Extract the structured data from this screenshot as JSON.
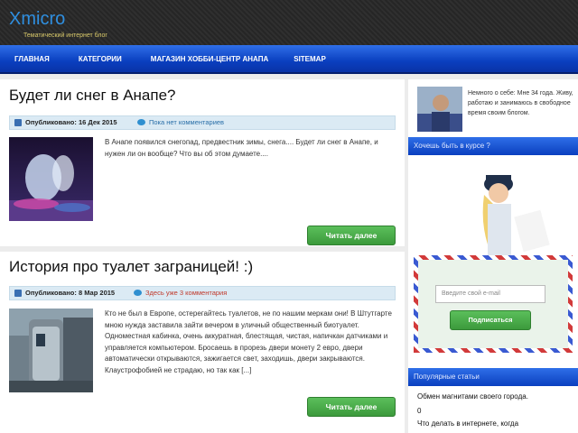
{
  "header": {
    "logo": "Xmicro",
    "tagline": "Тематический интернет блог"
  },
  "nav": {
    "items": [
      "Главная",
      "Категории",
      "Магазин хобби-центр Анапа",
      "Sitemap"
    ]
  },
  "posts": [
    {
      "title": "Будет ли снег в Анапе?",
      "date": "Опубликовано: 16 Дек 2015",
      "comments": "Пока нет комментариев",
      "excerpt": "В Анапе появился снегопад, предвестник зимы, снега.... Будет ли снег в Анапе, и нужен ли он вообще? Что вы об этом думаете....",
      "button": "Читать далее"
    },
    {
      "title": "История про туалет заграницей! :)",
      "date": "Опубликовано: 8 Мар 2015",
      "comments": "Здесь уже 3 комментария",
      "excerpt": "Кто не был в Европе, остерегайтесь туалетов, не по нашим меркам они! В Штутгарте мною нужда заставила зайти вечером в уличный общественный биотуалет. Одноместная кабинка, очень аккуратная, блестящая, чистая, напичкан датчиками и управляется компьютером. Бросаешь в прорезь двери монету 2 евро, двери автоматически открываются, зажигается свет, заходишь, двери закрываются. Клаустрофобией не страдаю, но так как [...]",
      "button": "Читать далее"
    }
  ],
  "sidebar": {
    "author_text": "Немного о себе: Мне 34 года. Живу, работаю и занимаюсь в свободное время своим блогом.",
    "subscribe_heading": "Хочешь быть в курсе ?",
    "email_placeholder": "Введите свой e-mail",
    "subscribe_button": "Подписаться",
    "popular_heading": "Популярные статьи",
    "popular": [
      "Обмен магнитами своего города.",
      "0",
      "Что делать в интернете, когда"
    ]
  },
  "colors": {
    "accent": "#0a3fbf",
    "button_green": "#4aab4a",
    "logo_blue": "#2f8fe0"
  }
}
